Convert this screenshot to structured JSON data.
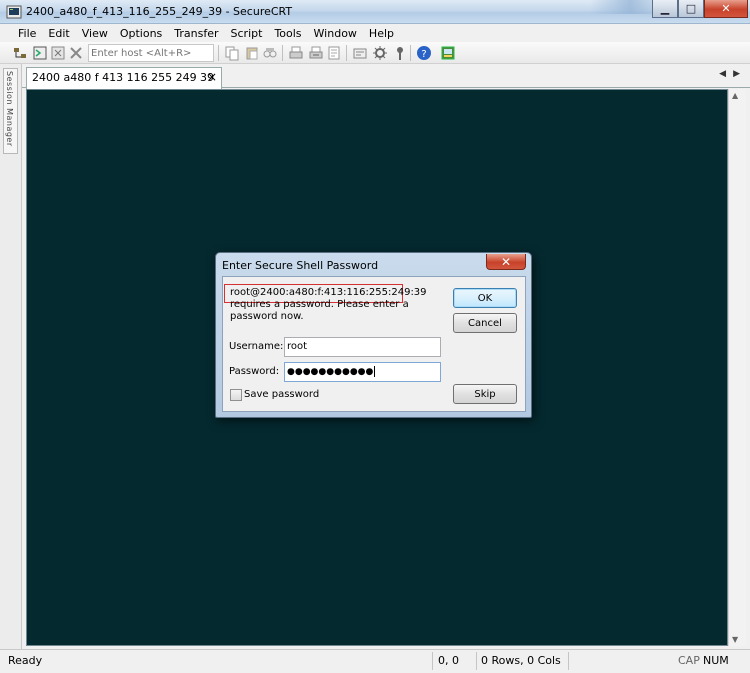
{
  "window": {
    "title": "2400_a480_f_413_116_255_249_39 - SecureCRT"
  },
  "menu": [
    "File",
    "Edit",
    "View",
    "Options",
    "Transfer",
    "Script",
    "Tools",
    "Window",
    "Help"
  ],
  "toolbar": {
    "host_placeholder": "Enter host <Alt+R>",
    "icons": [
      "connect-icon",
      "quick-connect-icon",
      "disconnect-icon",
      "copy-icon",
      "paste-icon",
      "find-icon",
      "print-icon",
      "print-selection-icon",
      "session-options-icon",
      "global-options-icon",
      "keymap-icon",
      "help-icon",
      "sftp-icon"
    ]
  },
  "session_manager": {
    "label": "Session Manager"
  },
  "tab": {
    "label": "2400 a480 f 413 116 255 249 39",
    "close": "×"
  },
  "dialog": {
    "title": "Enter Secure Shell Password",
    "message": "root@2400:a480:f:413:116:255:249:39 requires a password.  Please enter a password now.",
    "username_label": "Username:",
    "username_value": "root",
    "password_label": "Password:",
    "password_masked": "●●●●●●●●●●●",
    "save_password_label": "Save password",
    "save_password_checked": false,
    "ok_label": "OK",
    "cancel_label": "Cancel",
    "skip_label": "Skip"
  },
  "status": {
    "ready": "Ready",
    "cursor": "0, 0",
    "size": "0 Rows, 0 Cols",
    "cap": "CAP",
    "num": "NUM"
  },
  "colors": {
    "terminal_bg": "#04292f",
    "highlight_border": "#d43232"
  }
}
